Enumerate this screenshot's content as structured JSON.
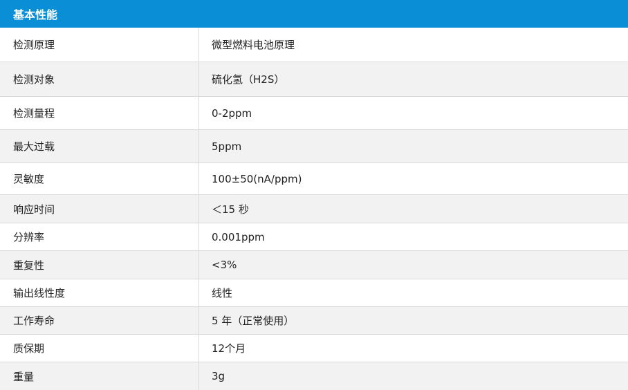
{
  "colors": {
    "header_bg": "#0a8fd6",
    "row_shaded": "#f2f2f2",
    "row_plain": "#ffffff",
    "border": "#d9d9d9"
  },
  "table": {
    "title": "基本性能",
    "rows": [
      {
        "label": "检测原理",
        "value": "微型燃料电池原理"
      },
      {
        "label": "检测对象",
        "value": "硫化氢（H2S）"
      },
      {
        "label": "检测量程",
        "value": "0-2ppm"
      },
      {
        "label": "最大过载",
        "value": "5ppm"
      },
      {
        "label": "灵敏度",
        "value": "100±50(nA/ppm)"
      },
      {
        "label": "响应时间",
        "value": "＜15 秒"
      },
      {
        "label": "分辨率",
        "value": "0.001ppm"
      },
      {
        "label": "重复性",
        "value": "<3%"
      },
      {
        "label": "输出线性度",
        "value": "线性"
      },
      {
        "label": "工作寿命",
        "value": "5 年（正常使用）"
      },
      {
        "label": "质保期",
        "value": "12个月"
      },
      {
        "label": "重量",
        "value": "3g"
      }
    ]
  }
}
